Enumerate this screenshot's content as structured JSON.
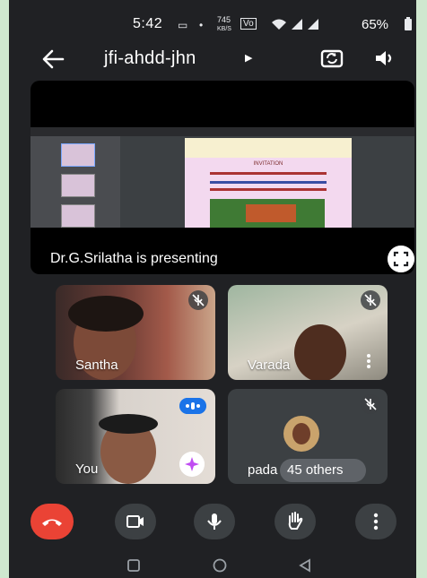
{
  "status_bar": {
    "time": "5:42",
    "net_speed": "745",
    "net_unit": "KB/S",
    "volte": "Vo",
    "battery": "65%"
  },
  "app_bar": {
    "meeting_code": "jfi-ahdd-jhn",
    "icons": [
      "back-arrow-icon",
      "dropdown-caret-icon",
      "switch-camera-icon",
      "speaker-icon"
    ]
  },
  "presentation": {
    "label": "Dr.G.Srilatha is presenting",
    "slide_heading": "INVITATION"
  },
  "participants": [
    {
      "name": "Santha",
      "muted": true
    },
    {
      "name": "Varada",
      "muted": true
    },
    {
      "name": "You",
      "speaking": true
    },
    {
      "name": "pada",
      "muted": true
    }
  ],
  "others": {
    "label": "45 others"
  },
  "controls": [
    "end-call-icon",
    "camera-icon",
    "microphone-icon",
    "raise-hand-icon",
    "more-options-icon"
  ],
  "colors": {
    "background": "#202124",
    "end_call": "#ea4335",
    "accent_blue": "#1a73e8",
    "tile": "#3c4043"
  }
}
